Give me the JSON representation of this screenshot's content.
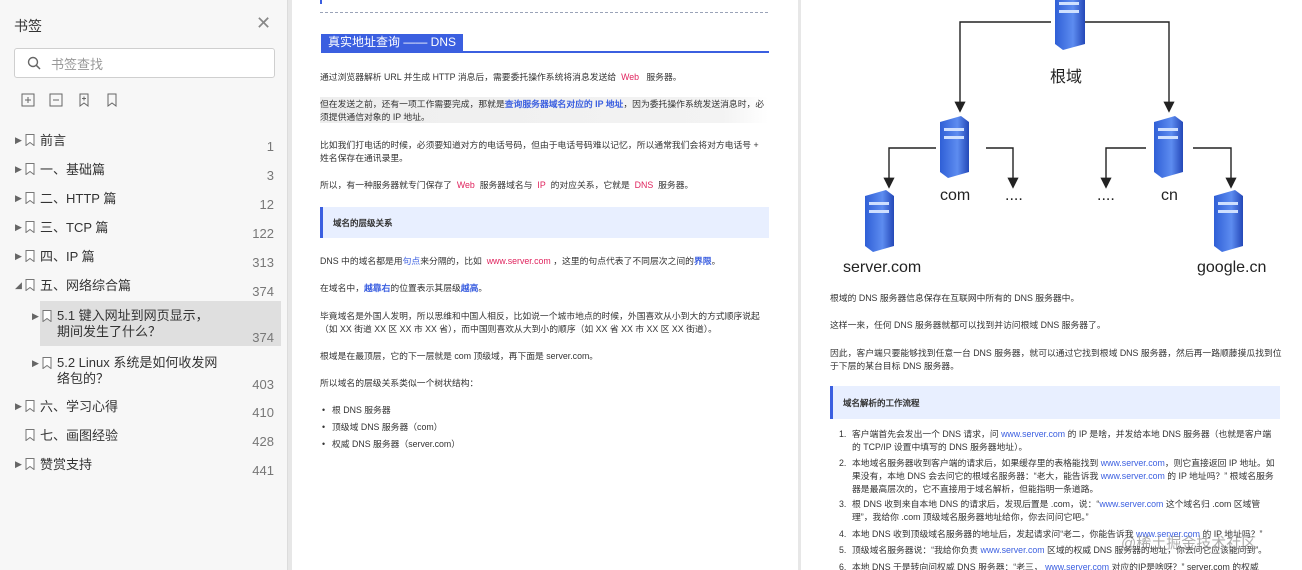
{
  "sidebar": {
    "title": "书签",
    "search_placeholder": "书签查找",
    "items": [
      {
        "label": "前言",
        "page": "1"
      },
      {
        "label": "一、基础篇",
        "page": "3"
      },
      {
        "label": "二、HTTP 篇",
        "page": "12"
      },
      {
        "label": "三、TCP 篇",
        "page": "122"
      },
      {
        "label": "四、IP 篇",
        "page": "313"
      },
      {
        "label": "五、网络综合篇",
        "page": "374"
      },
      {
        "label_line1": "5.1 键入网址到网页显示，",
        "label_line2": "期间发生了什么？",
        "page": "374"
      },
      {
        "label_line1": "5.2 Linux 系统是如何收发网",
        "label_line2": "络包的？",
        "page": "403"
      },
      {
        "label": "六、学习心得",
        "page": "410"
      },
      {
        "label": "七、画图经验",
        "page": "428"
      },
      {
        "label": "赞赏支持",
        "page": "441"
      }
    ]
  },
  "page1": {
    "heading": "真实地址查询 —— DNS",
    "p1_a": "通过浏览器解析 URL 并生成 HTTP 消息后，需要委托操作系统将消息发送给",
    "p1_web": "Web",
    "p1_b": "服务器。",
    "p2_a": "但在发送之前，还有一项工作需要完成，那就是",
    "p2_link": "查询服务器域名对应的 IP 地址",
    "p2_b": "，因为委托操作系统发送消息时，必须提供通信对象的 IP 地址。",
    "p3": "比如我们打电话的时候，必须要知道对方的电话号码，但由于电话号码难以记忆，所以通常我们会将对方电话号 + 姓名保存在通讯录里。",
    "p4_a": "所以，有一种服务器就专门保存了",
    "p4_web": "Web",
    "p4_b": "服务器域名与",
    "p4_ip": "IP",
    "p4_c": "的对应关系，它就是",
    "p4_dns": "DNS",
    "p4_d": "服务器。",
    "subhead": "域名的层级关系",
    "p5_a": "DNS 中的域名都是用",
    "p5_dot": "句点",
    "p5_b": "来分隔的，比如",
    "p5_url": "www.server.com",
    "p5_c": "，这里的句点代表了不同层次之间的",
    "p5_bound": "界限",
    "p5_d": "。",
    "p6_a": "在域名中，",
    "p6_right": "越靠右",
    "p6_b": "的位置表示其层级",
    "p6_high": "越高",
    "p6_c": "。",
    "p7": "毕竟域名是外国人发明，所以思维和中国人相反，比如说一个城市地点的时候，外国喜欢从小到大的方式顺序说起（如 XX 街道 XX 区 XX 市 XX 省），而中国则喜欢从大到小的顺序（如 XX 省 XX 市 XX 区 XX 街道）。",
    "p8": "根域是在最顶层，它的下一层就是 com 顶级域，再下面是 server.com。",
    "p9": "所以域名的层级关系类似一个树状结构：",
    "bullets": [
      "根 DNS 服务器",
      "顶级域 DNS 服务器（com）",
      "权威 DNS 服务器（server.com）"
    ]
  },
  "page2": {
    "diagram": {
      "root": "根域",
      "com": "com",
      "cn": "cn",
      "dots_left": "....",
      "dots_right": "....",
      "server": "server.com",
      "google": "google.cn"
    },
    "p1": "根域的 DNS 服务器信息保存在互联网中所有的 DNS 服务器中。",
    "p2": "这样一来，任何 DNS 服务器就都可以找到并访问根域 DNS 服务器了。",
    "p3": "因此，客户端只要能够找到任意一台 DNS 服务器，就可以通过它找到根域 DNS 服务器，然后再一路顺藤摸瓜找到位于下层的某台目标 DNS 服务器。",
    "subhead": "域名解析的工作流程",
    "steps": [
      {
        "num": "1.",
        "a": "客户端首先会发出一个 DNS 请求，问",
        "link": "www.server.com",
        "b": "的 IP 是啥，并发给本地 DNS 服务器（也就是客户端的 TCP/IP 设置中填写的 DNS 服务器地址）。"
      },
      {
        "num": "2.",
        "a": "本地域名服务器收到客户端的请求后，如果缓存里的表格能找到",
        "link": "www.server.com",
        "b": "，则它直接返回 IP 地址。如果没有，本地 DNS 会去问它的根域名服务器：“老大，能告诉我",
        "link2": "www.server.com",
        "c": "的 IP 地址吗？” 根域名服务器是最高层次的，它不直接用于域名解析，但能指明一条道路。"
      },
      {
        "num": "3.",
        "a": "根 DNS 收到来自本地 DNS 的请求后，发现后置是 .com，说：“",
        "link": "www.server.com",
        "b": "这个域名归 .com 区域管理”，我给你 .com 顶级域名服务器地址给你，你去问问它吧。”"
      },
      {
        "num": "4.",
        "a": "本地 DNS 收到顶级域名服务器的地址后，发起请求问“老二，你能告诉我",
        "link": "www.server.com",
        "b": "的 IP 地址吗？”"
      },
      {
        "num": "5.",
        "a": "顶级域名服务器说：“我给你负责",
        "link": "www.server.com",
        "b": "区域的权威 DNS 服务器的地址，你去问它应该能问到”。"
      },
      {
        "num": "6.",
        "a": "本地 DNS 于是转向问权威 DNS 服务器：“老三，",
        "link": "www.server.com",
        "b": "对应的IP是啥呀？” server.com 的权威"
      }
    ],
    "watermark": "@稀土掘金技术社区"
  },
  "colors": {
    "accent": "#3b5fe0",
    "highlight": "#e0245e",
    "sidebar_bg": "#f7f7f7",
    "selected_bg": "#dfdfdf"
  }
}
